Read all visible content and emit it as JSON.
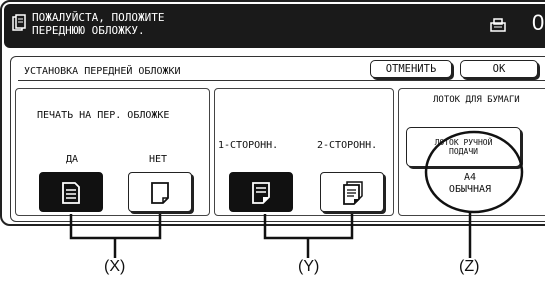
{
  "header": {
    "message_line1": "ПОЖАЛУЙСТА, ПОЛОЖИТЕ",
    "message_line2": "ПЕРЕДНЮЮ ОБЛОЖКУ.",
    "doc_icon": "document-icon",
    "job_icon": "job-status-icon",
    "count": "0"
  },
  "panel": {
    "title": "УСТАНОВКА ПЕРЕДНЕЙ ОБЛОЖКИ",
    "cancel_label": "ОТМЕНИТЬ",
    "ok_label": "OK"
  },
  "print_on_cover": {
    "title": "ПЕЧАТЬ НА ПЕР. ОБЛОЖКЕ",
    "yes_label": "ДА",
    "no_label": "НЕТ",
    "selected": "yes"
  },
  "sides": {
    "one_side_label": "1-СТОРОНН.",
    "two_side_label": "2-СТОРОНН.",
    "selected": "1-side"
  },
  "paper_tray": {
    "header": "ЛОТОК ДЛЯ БУМАГИ",
    "button_line1": "ЛОТОК РУЧНОЙ",
    "button_line2": "ПОДАЧИ",
    "size": "A4",
    "type": "ОБЫЧНАЯ"
  },
  "callouts": {
    "x": "(X)",
    "y": "(Y)",
    "z": "(Z)"
  },
  "colors": {
    "selected_fill": "#111111",
    "background": "#ffffff",
    "outline": "#222222"
  }
}
